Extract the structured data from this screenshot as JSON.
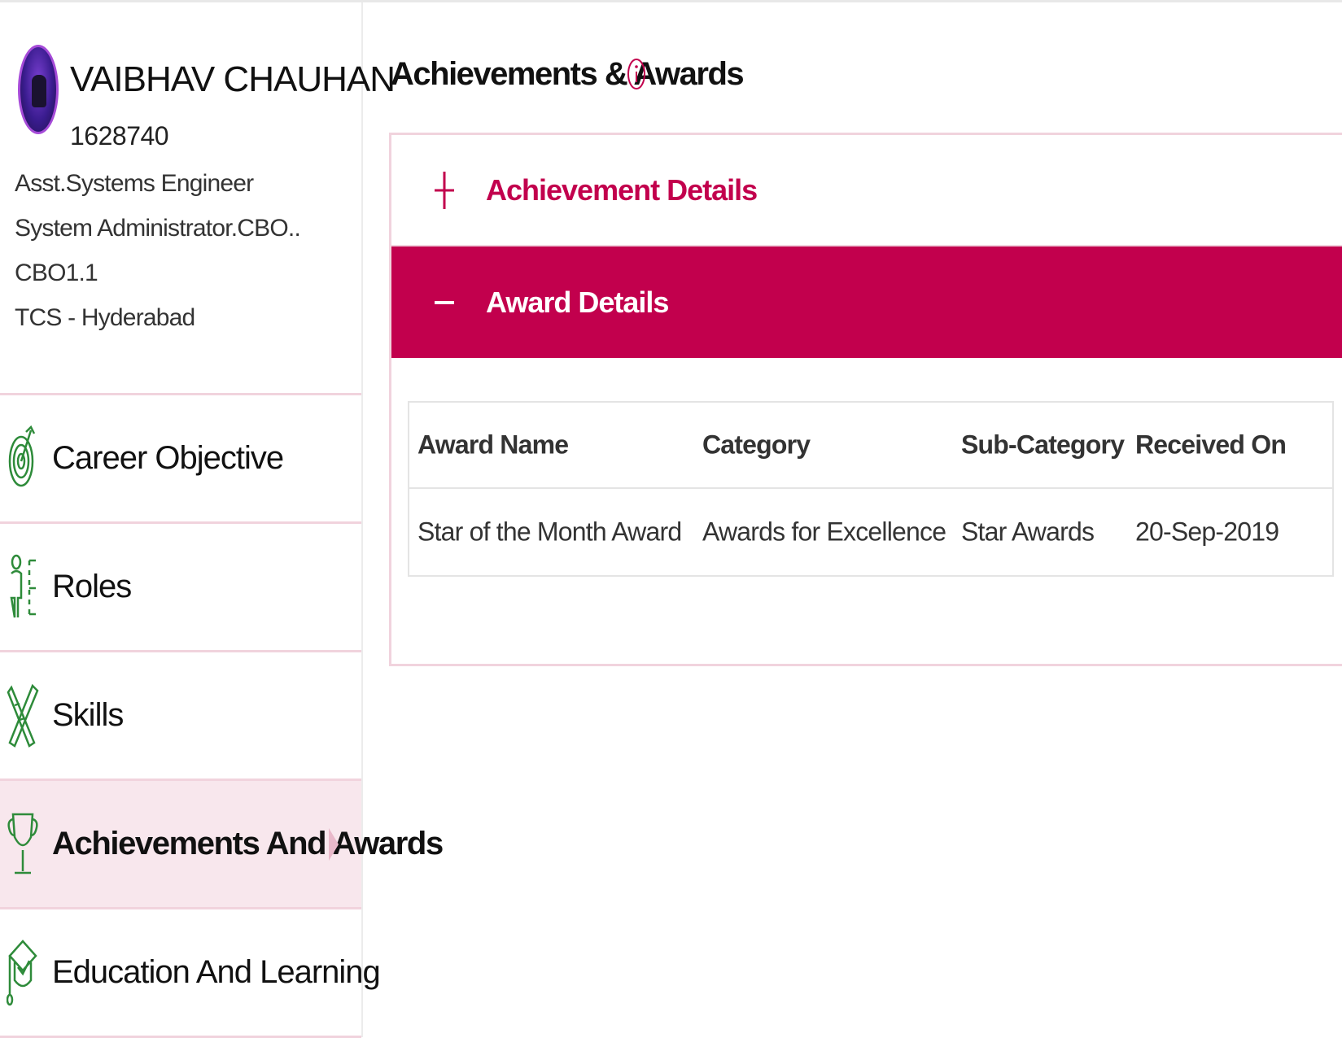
{
  "profile": {
    "name": "VAIBHAV CHAUHAN",
    "employee_id": "1628740",
    "designation": "Asst.Systems Engineer",
    "role": "System Administrator.CBO..",
    "grade": "CBO1.1",
    "location": "TCS - Hyderabad"
  },
  "sidebar": {
    "items": [
      {
        "label": "Career Objective",
        "icon": "target-icon"
      },
      {
        "label": "Roles",
        "icon": "roles-icon"
      },
      {
        "label": "Skills",
        "icon": "skills-icon"
      },
      {
        "label": "Achievements And Awards",
        "icon": "trophy-icon",
        "active": true
      },
      {
        "label": "Education And Learning",
        "icon": "graduation-icon"
      }
    ]
  },
  "main": {
    "title": "Achievements & Awards",
    "accordions": [
      {
        "label": "Achievement Details",
        "state": "collapsed"
      },
      {
        "label": "Award Details",
        "state": "expanded"
      }
    ],
    "awards_table": {
      "columns": [
        "Award Name",
        "Category",
        "Sub-Category",
        "Received On"
      ],
      "rows": [
        [
          "Star of the Month Award",
          "Awards for Excellence",
          "Star Awards",
          "20-Sep-2019"
        ]
      ]
    }
  },
  "colors": {
    "accent": "#c2004d",
    "active_bg": "#f8e7ed",
    "divider": "#f1d3dd",
    "icon_green": "#2e8b3a"
  }
}
